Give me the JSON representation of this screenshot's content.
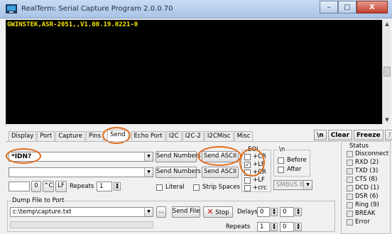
{
  "window": {
    "title": "RealTerm: Serial Capture Program 2.0.0.70",
    "minimize": "–",
    "maximize": "□",
    "close": "X"
  },
  "terminal": {
    "text": "GWINSTEK,ASR-2051,,V1.00.19.0221-0"
  },
  "tabs": [
    {
      "label": "Display"
    },
    {
      "label": "Port"
    },
    {
      "label": "Capture"
    },
    {
      "label": "Pins"
    },
    {
      "label": "Send"
    },
    {
      "label": "Echo Port"
    },
    {
      "label": "I2C"
    },
    {
      "label": "I2C-2"
    },
    {
      "label": "I2CMisc"
    },
    {
      "label": "Misc"
    }
  ],
  "toolbar": {
    "newline": "\\n",
    "clear": "Clear",
    "freeze": "Freeze",
    "help": "?"
  },
  "send": {
    "line1_value": "*IDN?",
    "line2_value": "",
    "send_numbers": "Send Numbers",
    "send_ascii": "Send ASCII",
    "zero_label": "0",
    "c_label": "^C",
    "lf_label": "LF",
    "repeats_label": "Repeats",
    "repeats_value": "1",
    "literal": "Literal",
    "strip_spaces": "Strip Spaces",
    "smbus_value": "SMBUS 8"
  },
  "eol": {
    "title": "EOL",
    "cr1": "+CR",
    "lf1": "+LF",
    "cr2": "+CR",
    "lf2": "+LF",
    "crc": "+crc"
  },
  "nl_group": {
    "title": "\\n",
    "before": "Before",
    "after": "After"
  },
  "dump": {
    "title": "Dump File to Port",
    "path": "c:\\temp\\capture.txt",
    "browse": "...",
    "send_file": "Send File",
    "stop": "Stop",
    "delays_label": "Delays",
    "delay1": "0",
    "delay2": "0",
    "repeats_label": "Repeats",
    "repeats1": "1",
    "repeats2": "0"
  },
  "status": {
    "title": "Status",
    "items": [
      {
        "label": "Disconnect"
      },
      {
        "label": "RXD (2)"
      },
      {
        "label": "TXD (3)"
      },
      {
        "label": "CTS (8)"
      },
      {
        "label": "DCD (1)"
      },
      {
        "label": "DSR (6)"
      },
      {
        "label": "Ring (9)"
      },
      {
        "label": "BREAK"
      },
      {
        "label": "Error"
      }
    ]
  },
  "colors": {
    "terminal_bg": "#000000",
    "terminal_text": "#f5e600",
    "highlight": "#e06c1a",
    "stop_icon": "#cc1111"
  },
  "icons": {
    "app": "realterm-app-icon",
    "stop": "red-x-icon"
  }
}
